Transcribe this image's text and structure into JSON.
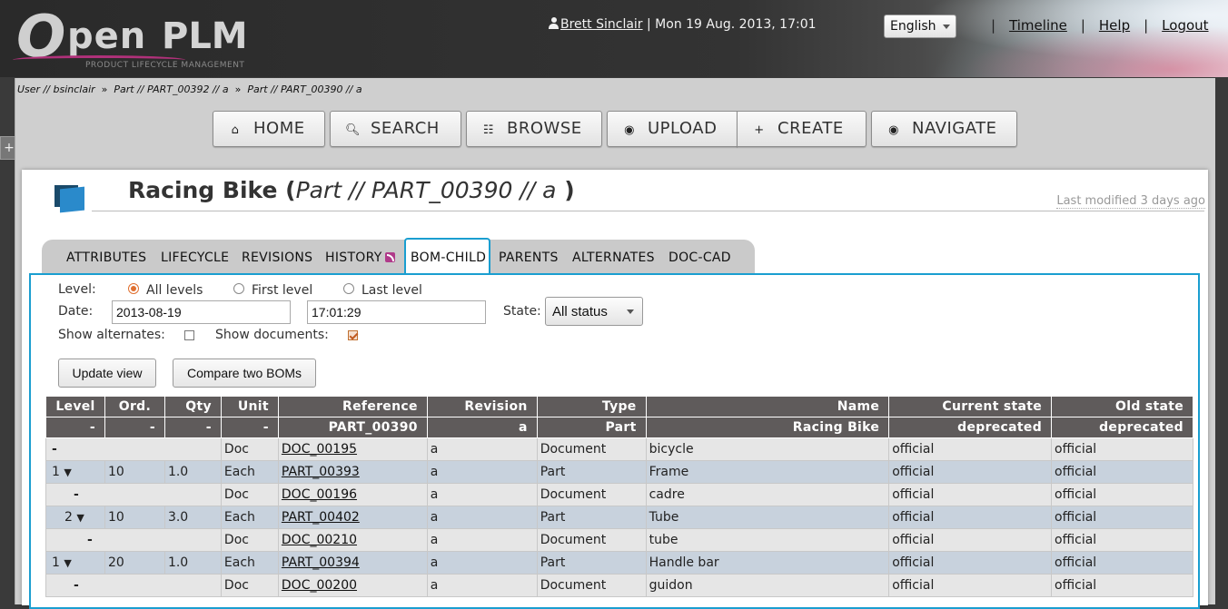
{
  "header": {
    "logo": {
      "o": "O",
      "pen": "pen",
      "plm": "PLM",
      "tagline": "PRODUCT LIFECYCLE MANAGEMENT"
    },
    "user_name": "Brett Sinclair",
    "user_date": "| Mon 19 Aug. 2013, 17:01",
    "language": "English",
    "links": {
      "timeline": "Timeline",
      "help": "Help",
      "logout": "Logout"
    }
  },
  "side_toggle": "+",
  "breadcrumb": [
    "User // bsinclair",
    "Part // PART_00392 // a",
    "Part // PART_00390 // a"
  ],
  "breadcrumb_sep": "»",
  "nav": {
    "home": "HOME",
    "search": "SEARCH",
    "browse": "BROWSE",
    "upload": "UPLOAD",
    "create": "CREATE",
    "navigate": "NAVIGATE"
  },
  "page": {
    "title_name": "Racing Bike (",
    "title_ref": "Part // PART_00390 //  a",
    "title_close": ")",
    "last_modified": "Last modified 3 days ago"
  },
  "tabs": [
    "ATTRIBUTES",
    "LIFECYCLE",
    "REVISIONS",
    "HISTORY",
    "BOM-CHILD",
    "PARENTS",
    "ALTERNATES",
    "DOC-CAD"
  ],
  "form": {
    "level_label": "Level:",
    "level_options": [
      "All levels",
      "First level",
      "Last level"
    ],
    "level_selected": "All levels",
    "date_label": "Date:",
    "date_value": "2013-08-19",
    "time_value": "17:01:29",
    "state_label": "State:",
    "state_value": "All status",
    "show_alternates_label": "Show alternates:",
    "show_alternates": false,
    "show_documents_label": "Show documents:",
    "show_documents": true,
    "update_button": "Update view",
    "compare_button": "Compare two BOMs"
  },
  "table": {
    "headers": [
      "Level",
      "Ord.",
      "Qty",
      "Unit",
      "Reference",
      "Revision",
      "Type",
      "Name",
      "Current state",
      "Old state"
    ],
    "root": [
      "-",
      "-",
      "-",
      "-",
      "PART_00390",
      "a",
      "Part",
      "Racing Bike",
      "deprecated",
      "deprecated"
    ],
    "rows": [
      {
        "kind": "doc",
        "level": "-",
        "ord": "",
        "qty": "",
        "unit": "Doc",
        "reference": "DOC_00195",
        "revision": "a",
        "type": "Document",
        "name": "bicycle",
        "current": "official",
        "old": "official"
      },
      {
        "kind": "part",
        "level": "1",
        "ord": "10",
        "qty": "1.0",
        "unit": "Each",
        "reference": "PART_00393",
        "revision": "a",
        "type": "Part",
        "name": "Frame",
        "current": "official",
        "old": "official"
      },
      {
        "kind": "doc",
        "level": "-",
        "ord": "",
        "qty": "",
        "unit": "Doc",
        "reference": "DOC_00196",
        "revision": "a",
        "type": "Document",
        "name": "cadre",
        "current": "official",
        "old": "official"
      },
      {
        "kind": "part",
        "level": "2",
        "ord": "10",
        "qty": "3.0",
        "unit": "Each",
        "reference": "PART_00402",
        "revision": "a",
        "type": "Part",
        "name": "Tube",
        "current": "official",
        "old": "official"
      },
      {
        "kind": "doc",
        "level": "-",
        "ord": "",
        "qty": "",
        "unit": "Doc",
        "reference": "DOC_00210",
        "revision": "a",
        "type": "Document",
        "name": "tube",
        "current": "official",
        "old": "official"
      },
      {
        "kind": "part",
        "level": "1",
        "ord": "20",
        "qty": "1.0",
        "unit": "Each",
        "reference": "PART_00394",
        "revision": "a",
        "type": "Part",
        "name": "Handle bar",
        "current": "official",
        "old": "official"
      },
      {
        "kind": "doc",
        "level": "-",
        "ord": "",
        "qty": "",
        "unit": "Doc",
        "reference": "DOC_00200",
        "revision": "a",
        "type": "Document",
        "name": "guidon",
        "current": "official",
        "old": "official"
      }
    ],
    "expand_glyph": "▼"
  },
  "colors": {
    "accent": "#1a9ed0",
    "header_bg": "#333333",
    "table_header": "#5f5b5b",
    "part_row": "#c8d2dd",
    "doc_row": "#e6e6e6",
    "radio_on": "#e07030"
  },
  "icons": {
    "home": "home-icon",
    "search": "search-icon",
    "browse": "list-icon",
    "upload": "upload-icon",
    "create": "plus-icon",
    "navigate": "eye-icon",
    "rss": "rss-icon",
    "user": "user-icon",
    "part": "part-icon"
  }
}
